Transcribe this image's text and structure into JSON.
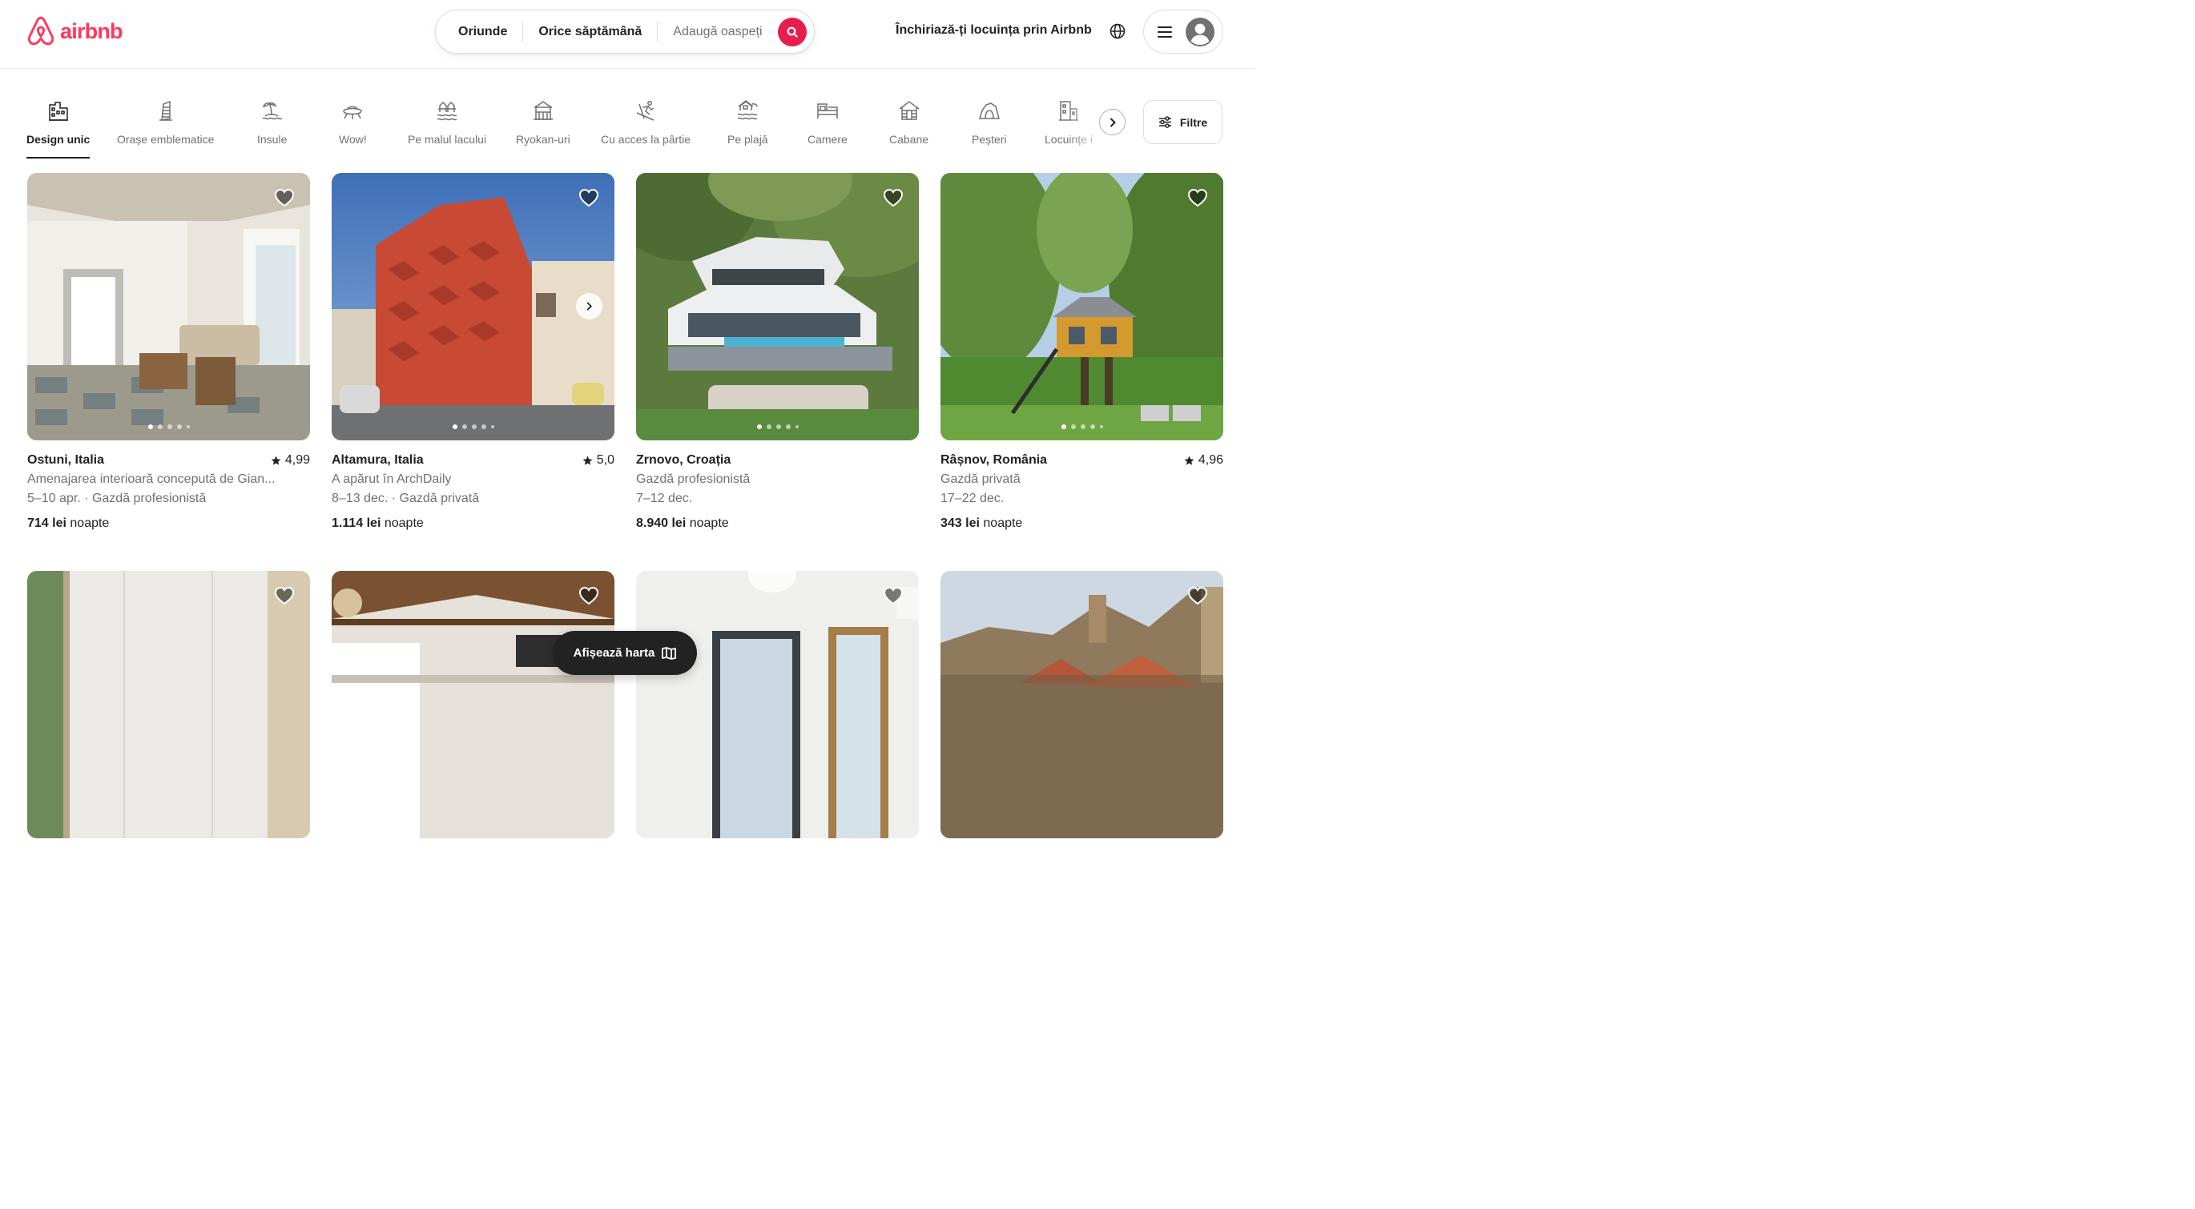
{
  "brand": {
    "name": "airbnb",
    "color": "#ff385c"
  },
  "search": {
    "location": "Oriunde",
    "dates": "Orice săptămână",
    "guests_placeholder": "Adaugă oaspeți",
    "button_icon": "search-icon"
  },
  "header": {
    "host_link": "Închiriază-ți locuința prin Airbnb",
    "language_icon": "globe-icon",
    "menu_icon": "hamburger-icon",
    "avatar_icon": "user-avatar-icon"
  },
  "categories": [
    {
      "label": "Design unic",
      "icon": "design-icon",
      "active": true
    },
    {
      "label": "Orașe emblematice",
      "icon": "tower-icon"
    },
    {
      "label": "Insule",
      "icon": "island-icon"
    },
    {
      "label": "Wow!",
      "icon": "ufo-icon"
    },
    {
      "label": "Pe malul lacului",
      "icon": "lake-icon"
    },
    {
      "label": "Ryokan-uri",
      "icon": "ryokan-icon"
    },
    {
      "label": "Cu acces la pârtie",
      "icon": "ski-icon"
    },
    {
      "label": "Pe plajă",
      "icon": "beach-icon"
    },
    {
      "label": "Camere",
      "icon": "bed-icon"
    },
    {
      "label": "Cabane",
      "icon": "cabin-icon"
    },
    {
      "label": "Peșteri",
      "icon": "cave-icon"
    },
    {
      "label": "Locuințe i",
      "icon": "building-icon"
    }
  ],
  "filters": {
    "label": "Filtre",
    "icon": "sliders-icon"
  },
  "listings": [
    {
      "location": "Ostuni, Italia",
      "rating": "4,99",
      "line2": "Amenajarea interioară concepută de Gian...",
      "line3": "5–10 apr. · Gazdă profesionistă",
      "price": "714 lei",
      "price_unit": "noapte"
    },
    {
      "location": "Altamura, Italia",
      "rating": "5,0",
      "line2": "A apărut în ArchDaily",
      "line3": "8–13 dec. · Gazdă privată",
      "price": "1.114 lei",
      "price_unit": "noapte"
    },
    {
      "location": "Zrnovo, Croația",
      "rating": "",
      "line2": "Gazdă profesionistă",
      "line3": "7–12 dec.",
      "price": "8.940 lei",
      "price_unit": "noapte"
    },
    {
      "location": "Râșnov, România",
      "rating": "4,96",
      "line2": "Gazdă privată",
      "line3": "17–22 dec.",
      "price": "343 lei",
      "price_unit": "noapte"
    }
  ],
  "map_button": {
    "label": "Afișează harta",
    "icon": "map-icon"
  }
}
